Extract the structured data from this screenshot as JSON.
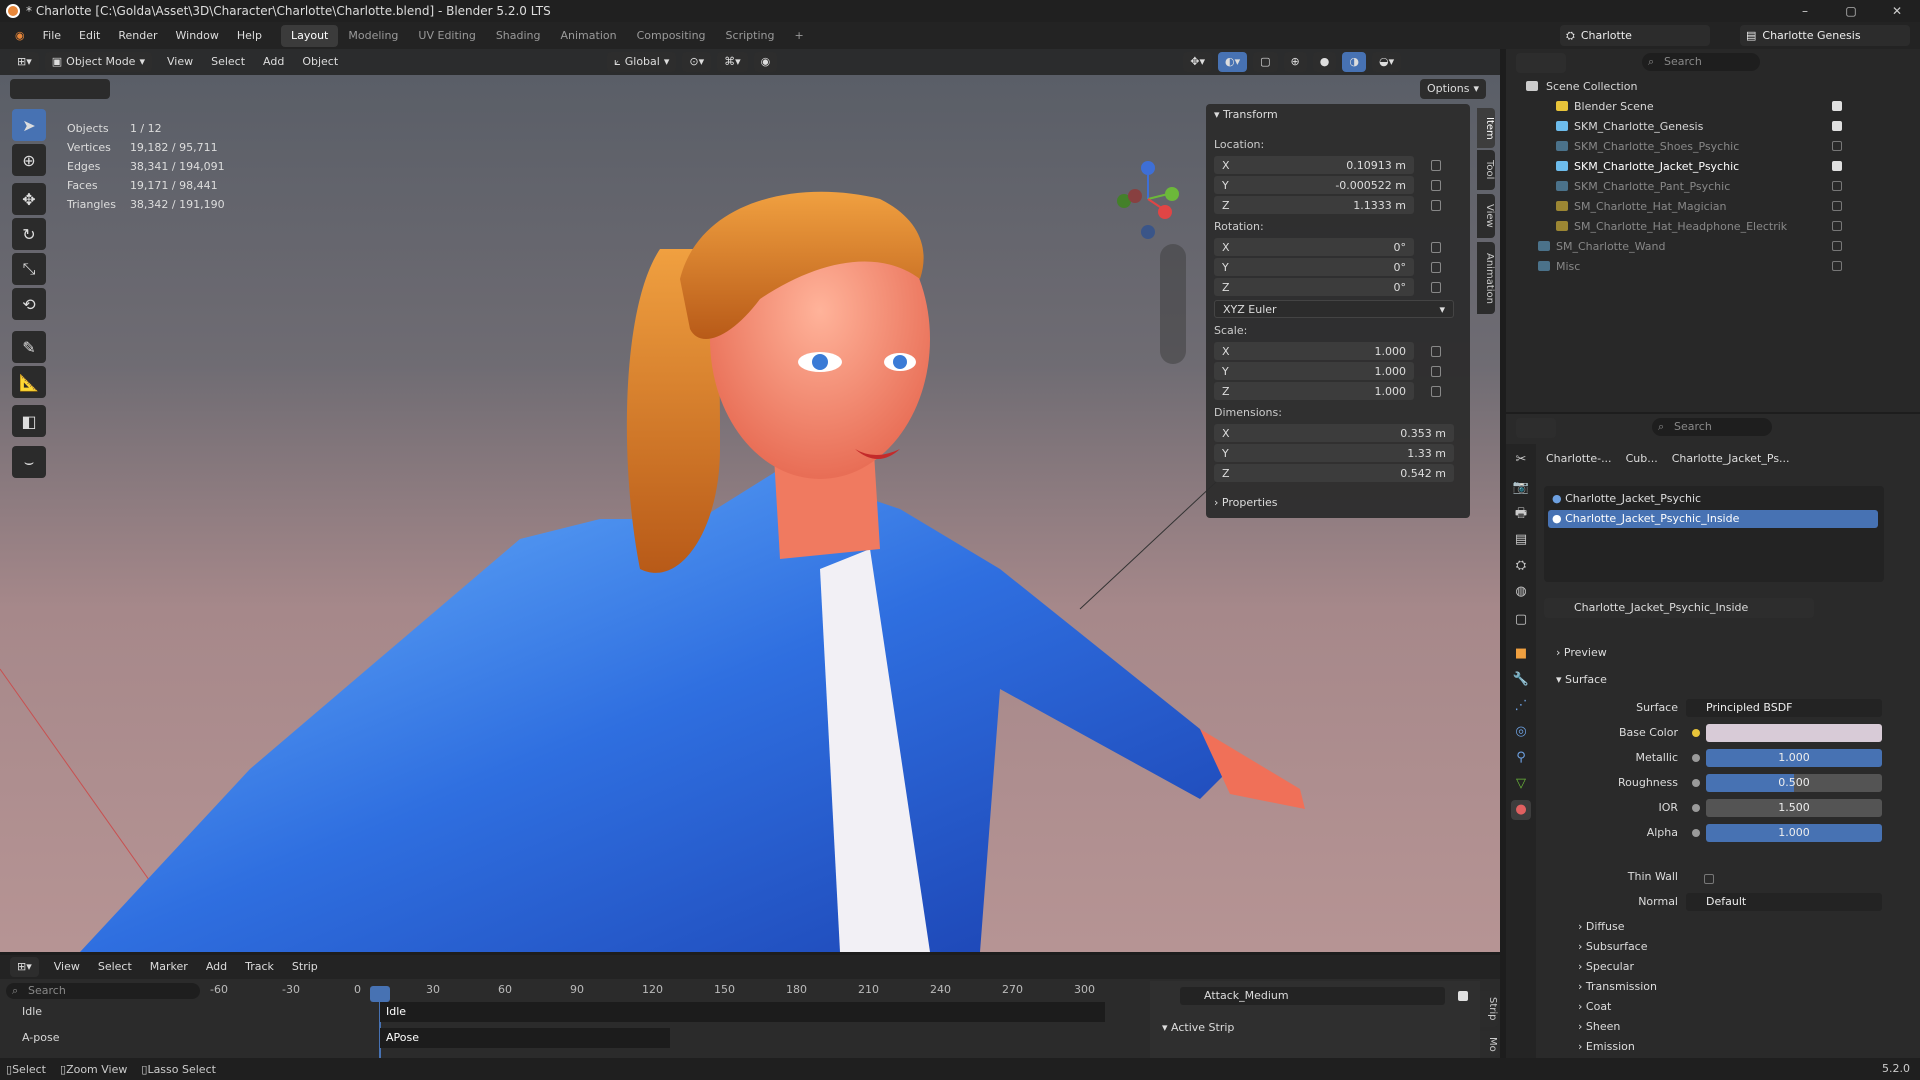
{
  "window": {
    "title": "* Charlotte [C:\\Golda\\Asset\\3D\\Character\\Charlotte\\Charlotte.blend] - Blender 5.2.0 LTS",
    "controls": [
      "–",
      "▢",
      "✕"
    ]
  },
  "menu": [
    "File",
    "Edit",
    "Render",
    "Window",
    "Help"
  ],
  "workspaces": [
    "Layout",
    "Modeling",
    "UV Editing",
    "Shading",
    "Animation",
    "Compositing",
    "Scripting",
    "+"
  ],
  "scene": {
    "name": "Charlotte",
    "view_layer": "Charlotte Genesis"
  },
  "viewport": {
    "mode": "Object Mode",
    "menus": [
      "View",
      "Select",
      "Add",
      "Object"
    ],
    "orientation": "Global",
    "options": "Options",
    "stats": [
      [
        "Objects",
        "1 / 12"
      ],
      [
        "Vertices",
        "19,182 / 95,711"
      ],
      [
        "Edges",
        "38,341 / 194,091"
      ],
      [
        "Faces",
        "19,171 / 98,441"
      ],
      [
        "Triangles",
        "38,342 / 191,190"
      ]
    ]
  },
  "npanel": {
    "transform_title": "Transform",
    "location_label": "Location:",
    "location": [
      [
        "X",
        "0.10913 m"
      ],
      [
        "Y",
        "-0.000522 m"
      ],
      [
        "Z",
        "1.1333 m"
      ]
    ],
    "rotation_label": "Rotation:",
    "rotation": [
      [
        "X",
        "0°"
      ],
      [
        "Y",
        "0°"
      ],
      [
        "Z",
        "0°"
      ]
    ],
    "rotation_mode": "XYZ Euler",
    "scale_label": "Scale:",
    "scale": [
      [
        "X",
        "1.000"
      ],
      [
        "Y",
        "1.000"
      ],
      [
        "Z",
        "1.000"
      ]
    ],
    "dimensions_label": "Dimensions:",
    "dimensions": [
      [
        "X",
        "0.353 m"
      ],
      [
        "Y",
        "1.33 m"
      ],
      [
        "Z",
        "0.542 m"
      ]
    ],
    "properties_title": "Properties",
    "tabs": [
      "Item",
      "Tool",
      "View",
      "Animation"
    ]
  },
  "outliner": {
    "search_placeholder": "Search",
    "root": "Scene Collection",
    "items": [
      "Blender Scene",
      "SKM_Charlotte_Genesis",
      "SKM_Charlotte_Shoes_Psychic",
      "SKM_Charlotte_Jacket_Psychic",
      "SKM_Charlotte_Pant_Psychic",
      "SM_Charlotte_Hat_Magician",
      "SM_Charlotte_Hat_Headphone_Electrik",
      "SM_Charlotte_Wand",
      "Misc"
    ]
  },
  "properties": {
    "search_placeholder": "Search",
    "breadcrumb": [
      "Charlotte-...",
      "Cub...",
      "Charlotte_Jacket_Ps..."
    ],
    "slots": [
      "Charlotte_Jacket_Psychic",
      "Charlotte_Jacket_Psychic_Inside"
    ],
    "material": "Charlotte_Jacket_Psychic_Inside",
    "sections": {
      "preview": "Preview",
      "surface": "Surface"
    },
    "surface_label": "Surface",
    "surface_value": "Principled BSDF",
    "rows": [
      {
        "label": "Base Color",
        "value": "",
        "fill": 0,
        "color": "#d8cbd7"
      },
      {
        "label": "Metallic",
        "value": "1.000",
        "fill": 1.0
      },
      {
        "label": "Roughness",
        "value": "0.500",
        "fill": 0.5
      },
      {
        "label": "IOR",
        "value": "1.500",
        "fill": 0
      },
      {
        "label": "Alpha",
        "value": "1.000",
        "fill": 1.0
      }
    ],
    "thin_wall": "Thin Wall",
    "normal_label": "Normal",
    "normal_value": "Default",
    "subsections": [
      "Diffuse",
      "Subsurface",
      "Specular",
      "Transmission",
      "Coat",
      "Sheen",
      "Emission"
    ]
  },
  "timeline": {
    "menus": [
      "View",
      "Select",
      "Marker",
      "Add",
      "Track",
      "Strip"
    ],
    "search_placeholder": "Search",
    "tracks": [
      "Idle",
      "A-pose"
    ],
    "frames": [
      "-60",
      "-30",
      "0",
      "30",
      "60",
      "90",
      "120",
      "150",
      "180",
      "210",
      "240",
      "270",
      "300"
    ],
    "strips": [
      "Idle",
      "APose"
    ],
    "action": "Attack_Medium",
    "active_strip": "Active Strip",
    "side_tabs": [
      "Strip",
      "Mo"
    ]
  },
  "statusbar": {
    "items": [
      "Select",
      "Zoom View",
      "Lasso Select"
    ],
    "version": "5.2.0"
  }
}
